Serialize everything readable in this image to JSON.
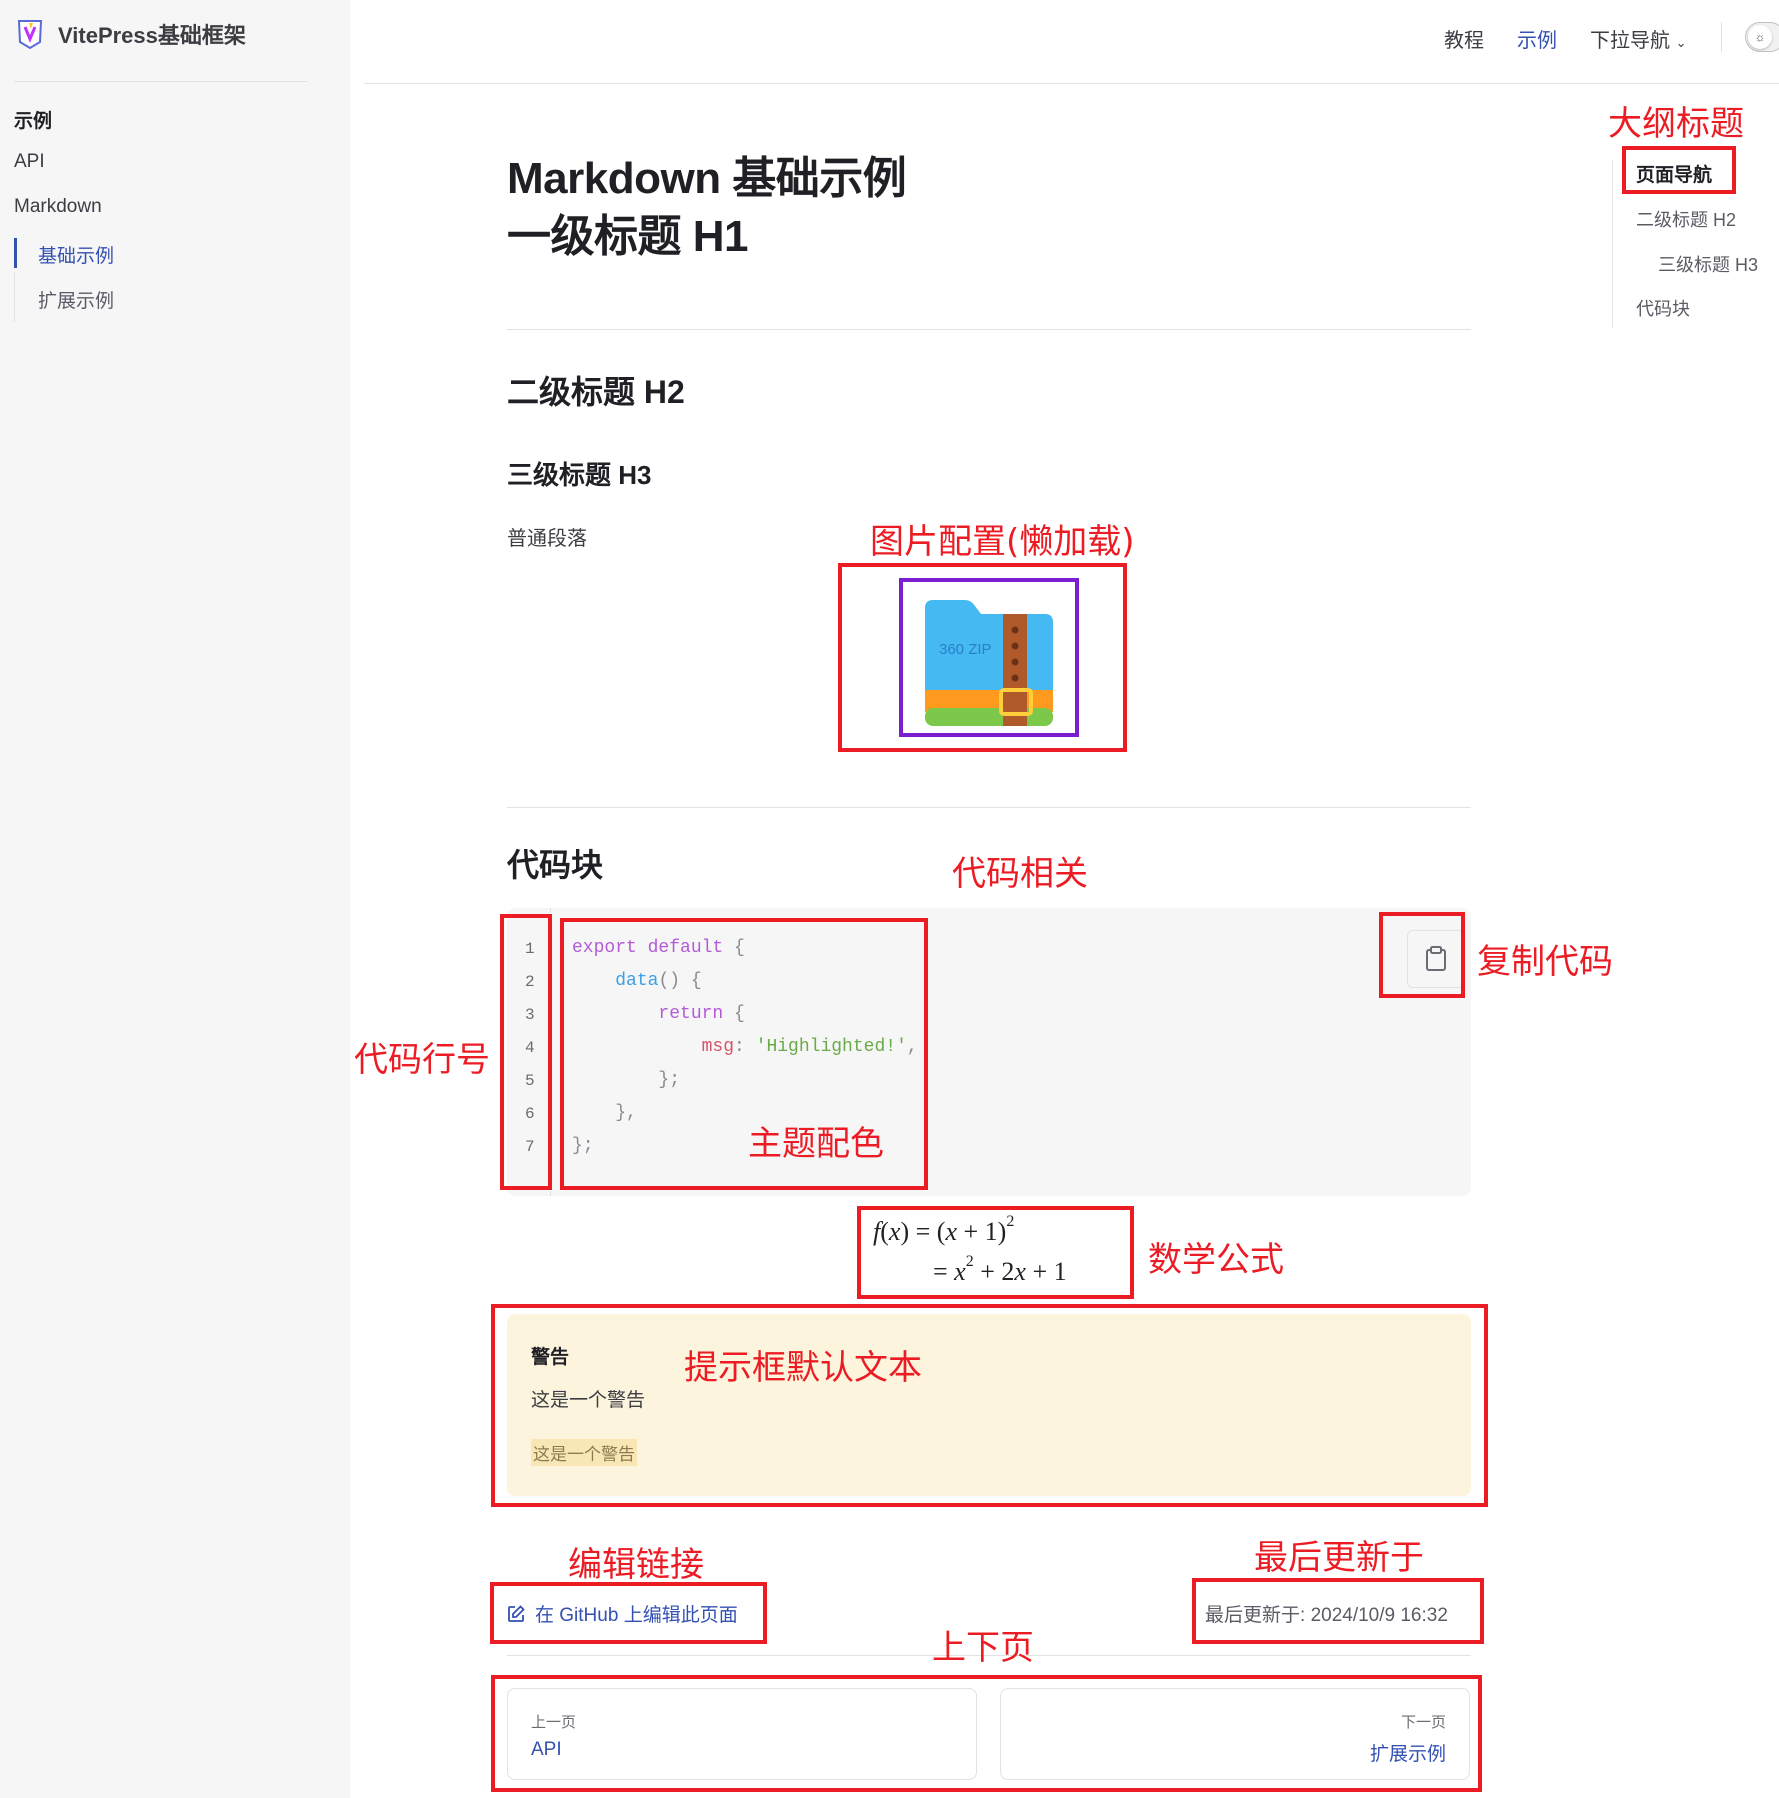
{
  "brand": {
    "title": "VitePress基础框架",
    "logo_icon": "vitepress-logo-icon"
  },
  "nav": {
    "items": [
      "教程",
      "示例",
      "下拉导航"
    ],
    "active": "示例",
    "accent": "#3451b2"
  },
  "sidebar": {
    "groups": [
      {
        "label": "示例"
      },
      {
        "label": "API"
      },
      {
        "label": "Markdown"
      }
    ],
    "sub_items": [
      {
        "label": "基础示例",
        "active": true
      },
      {
        "label": "扩展示例",
        "active": false
      }
    ]
  },
  "content": {
    "h1_line1": "Markdown 基础示例",
    "h1_line2": "一级标题 H1",
    "h2": "二级标题 H2",
    "h3": "三级标题 H3",
    "paragraph": "普通段落",
    "code_heading": "代码块",
    "image_alt_text": "360 ZIP"
  },
  "code": {
    "line_numbers": [
      "1",
      "2",
      "3",
      "4",
      "5",
      "6",
      "7"
    ],
    "lines": [
      "export default {",
      "    data() {",
      "        return {",
      "            msg: 'Highlighted!',",
      "        };",
      "    },",
      "};"
    ]
  },
  "math": {
    "line1": "f(x) = (x + 1)²",
    "line2": "= x² + 2x + 1"
  },
  "warning": {
    "title": "警告",
    "body": "这是一个警告",
    "marked": "这是一个警告",
    "bg_color": "#fcf4dc"
  },
  "footer": {
    "edit_link": "在 GitHub 上编辑此页面",
    "last_updated_label": "最后更新于:",
    "last_updated_value": "2024/10/9 16:32"
  },
  "pager": {
    "prev_label": "上一页",
    "prev_link": "API",
    "next_label": "下一页",
    "next_link": "扩展示例"
  },
  "outline": {
    "title": "页面导航",
    "items": [
      "二级标题 H2",
      "三级标题 H3",
      "代码块"
    ]
  },
  "annotations": {
    "outline_title": "大纲标题",
    "image_config": "图片配置(懒加载)",
    "code_related": "代码相关",
    "copy_code": "复制代码",
    "line_numbers": "代码行号",
    "theme_colors": "主题配色",
    "math_formula": "数学公式",
    "alert_default_text": "提示框默认文本",
    "edit_link": "编辑链接",
    "last_updated": "最后更新于",
    "prev_next": "上下页",
    "color": "#ec1c24"
  }
}
